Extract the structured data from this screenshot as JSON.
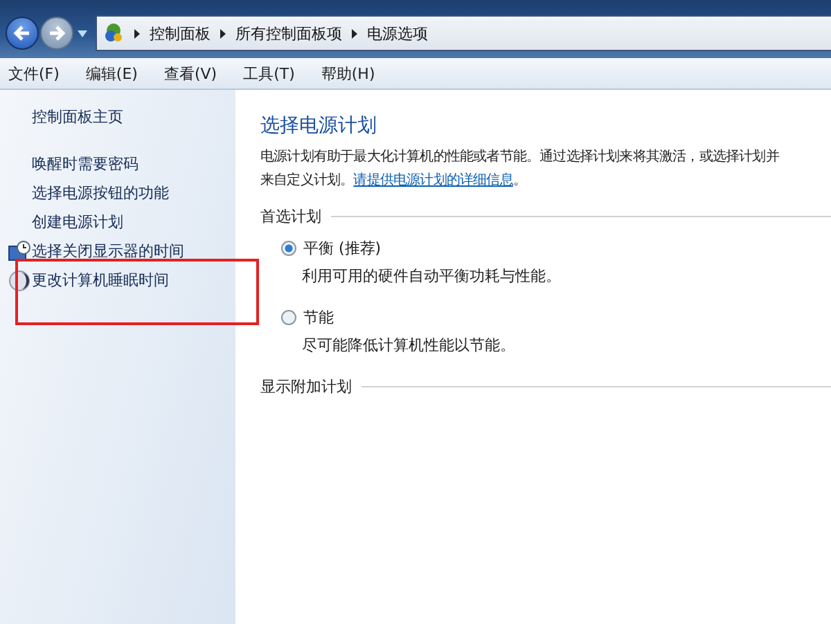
{
  "navigation": {
    "back": {
      "disabled": false
    },
    "forward": {
      "disabled": true
    }
  },
  "breadcrumb": [
    "控制面板",
    "所有控制面板项",
    "电源选项"
  ],
  "menu": [
    "文件(F)",
    "编辑(E)",
    "查看(V)",
    "工具(T)",
    "帮助(H)"
  ],
  "sidebar": {
    "home": "控制面板主页",
    "items": [
      {
        "label": "唤醒时需要密码",
        "kind": "plain"
      },
      {
        "label": "选择电源按钮的功能",
        "kind": "plain"
      },
      {
        "label": "创建电源计划",
        "kind": "plain"
      },
      {
        "label": "选择关闭显示器的时间",
        "kind": "monitor"
      },
      {
        "label": "更改计算机睡眠时间",
        "kind": "moon",
        "highlighted": true
      }
    ]
  },
  "content": {
    "title": "选择电源计划",
    "description": {
      "line_1": "电源计划有助于最大化计算机的性能或者节能。通过选择计划来将其激活，或选择计划并",
      "line_2": "来自定义计划。",
      "link": "请提供电源计划的详细信息",
      "after": "。"
    },
    "preferred_heading": "首选计划",
    "plans": [
      {
        "name": "平衡 (推荐)",
        "description": "利用可用的硬件自动平衡功耗与性能。",
        "selected": true
      },
      {
        "name": "节能",
        "description": "尽可能降低计算机性能以节能。",
        "selected": false
      }
    ],
    "additional_heading": "显示附加计划"
  }
}
